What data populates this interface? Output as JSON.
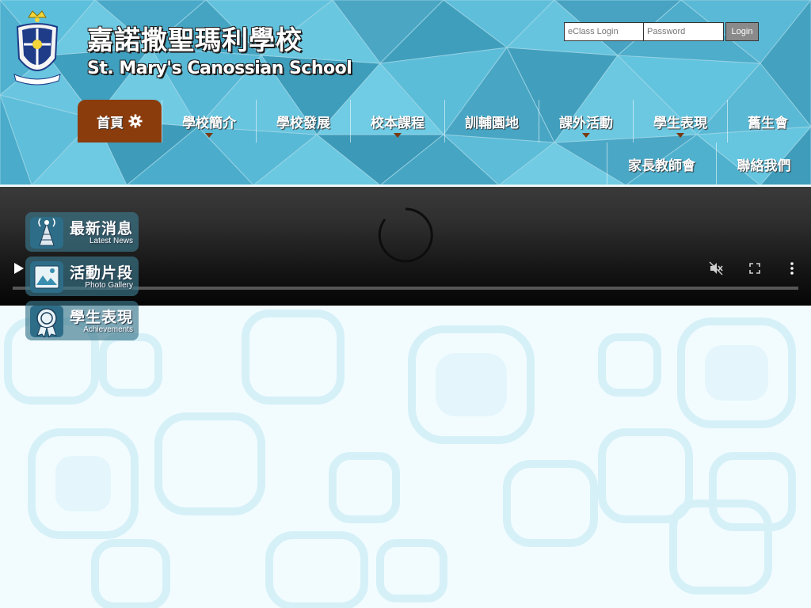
{
  "school": {
    "name_zh": "嘉諾撒聖瑪利學校",
    "name_en": "St. Mary's Canossian School"
  },
  "login": {
    "user_placeholder": "eClass Login",
    "pass_placeholder": "Password",
    "button_label": "Login"
  },
  "nav": {
    "items": [
      {
        "label": "首頁",
        "icon": "gear-icon",
        "active": true,
        "has_submenu": false
      },
      {
        "label": "學校簡介",
        "has_submenu": true
      },
      {
        "label": "學校發展",
        "has_submenu": false
      },
      {
        "label": "校本課程",
        "has_submenu": true
      },
      {
        "label": "訓輔園地",
        "has_submenu": false
      },
      {
        "label": "課外活動",
        "has_submenu": true
      },
      {
        "label": "學生表現",
        "has_submenu": true
      },
      {
        "label": "舊生會",
        "has_submenu": false
      },
      {
        "label": "家長教師會",
        "has_submenu": false
      },
      {
        "label": "聯絡我們",
        "has_submenu": false
      }
    ]
  },
  "video": {
    "controls": [
      "play-icon",
      "mute-icon",
      "fullscreen-icon",
      "more-icon"
    ]
  },
  "quick_links": [
    {
      "zh": "最新消息",
      "en": "Latest News",
      "icon": "broadcast-tower-icon"
    },
    {
      "zh": "活動片段",
      "en": "Photo Gallery",
      "icon": "photo-gallery-icon"
    },
    {
      "zh": "學生表現",
      "en": "Achievements",
      "icon": "award-ribbon-icon"
    }
  ],
  "colors": {
    "header_bg": "#56b7d5",
    "nav_active": "#8b3c0c",
    "page_bg": "#f2fcff"
  }
}
